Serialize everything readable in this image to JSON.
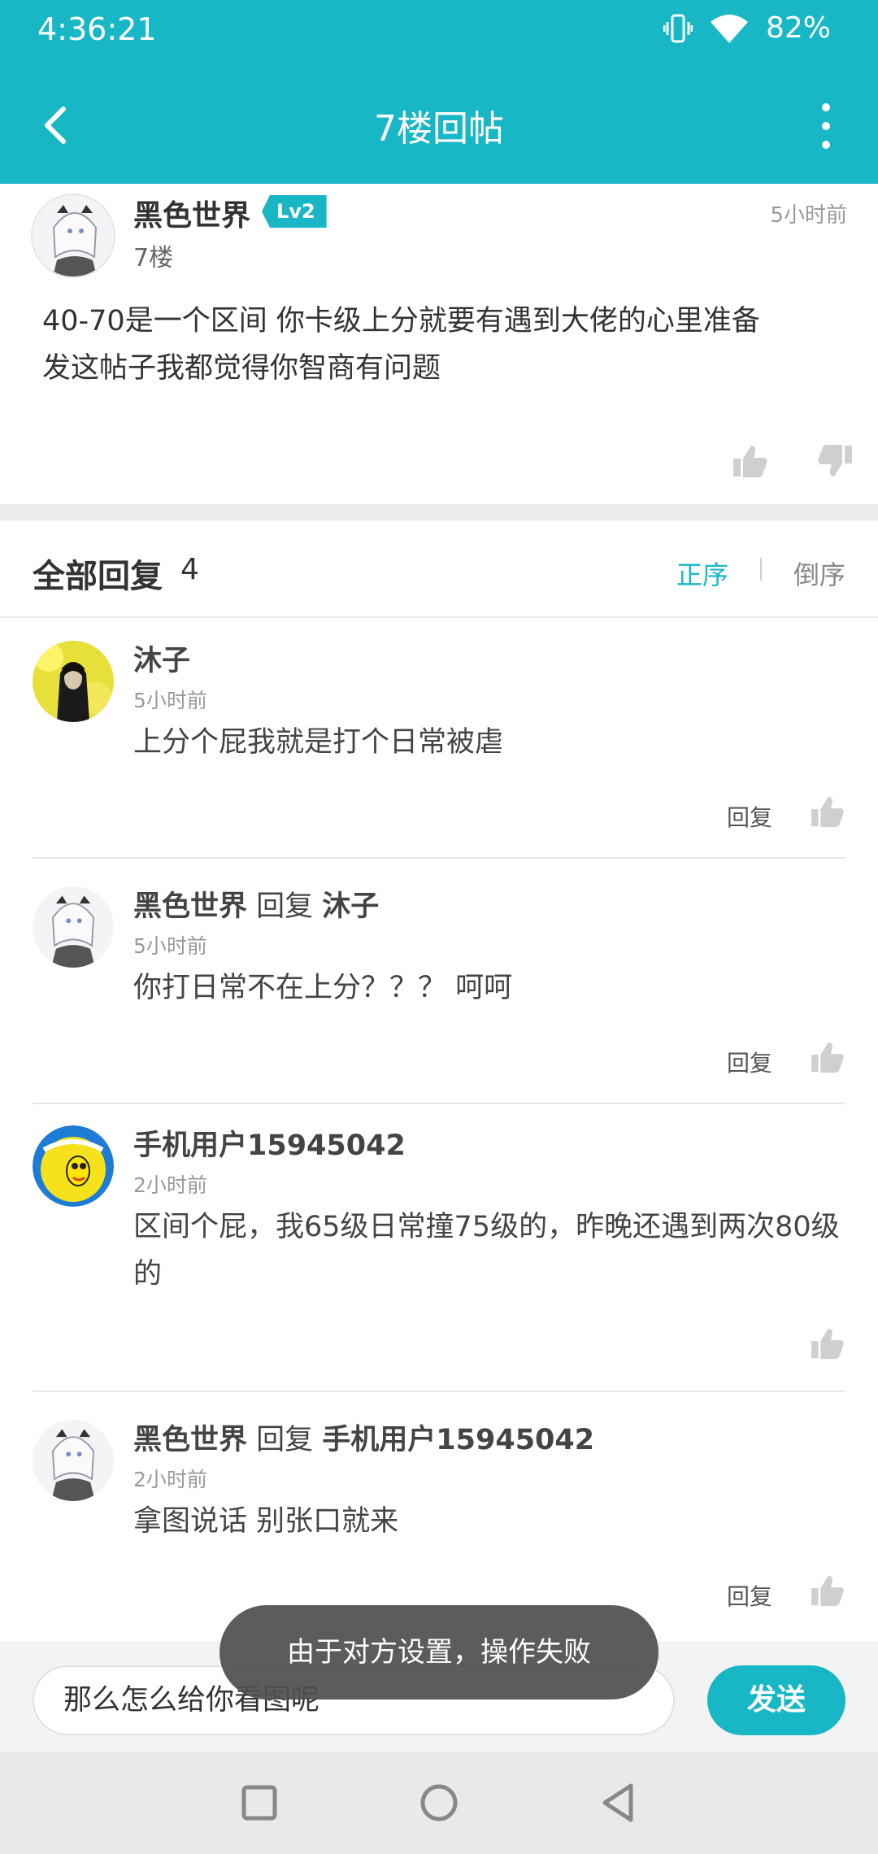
{
  "status_bar": {
    "time": "4:36:21",
    "battery": "82%"
  },
  "app_bar": {
    "title": "7楼回帖"
  },
  "post": {
    "author": "黑色世界",
    "level": "Lv2",
    "floor": "7楼",
    "time": "5小时前",
    "content_line1": "40-70是一个区间  你卡级上分就要有遇到大佬的心里准备",
    "content_line2": "发这帖子我都觉得你智商有问题"
  },
  "replies_header": {
    "label": "全部回复",
    "count": "4",
    "sort_asc": "正序",
    "sort_desc": "倒序"
  },
  "replies": [
    {
      "name": "沐子",
      "reply_word": "",
      "target": "",
      "time": "5小时前",
      "text": "上分个屁我就是打个日常被虐",
      "reply_label": "回复"
    },
    {
      "name": "黑色世界",
      "reply_word": " 回复 ",
      "target": "沐子",
      "time": "5小时前",
      "text": "你打日常不在上分？？？    呵呵",
      "reply_label": "回复"
    },
    {
      "name": "手机用户15945042",
      "reply_word": "",
      "target": "",
      "time": "2小时前",
      "text": "区间个屁，我65级日常撞75级的，昨晚还遇到两次80级的",
      "reply_label": ""
    },
    {
      "name": "黑色世界",
      "reply_word": " 回复 ",
      "target": "手机用户15945042",
      "time": "2小时前",
      "text": "拿图说话  别张口就来",
      "reply_label": "回复"
    }
  ],
  "toast": "由于对方设置，操作失败",
  "input": {
    "value": "那么怎么给你看图呢",
    "send_label": "发送"
  },
  "colors": {
    "accent": "#17b7c6",
    "toast_bg": "#505050"
  }
}
